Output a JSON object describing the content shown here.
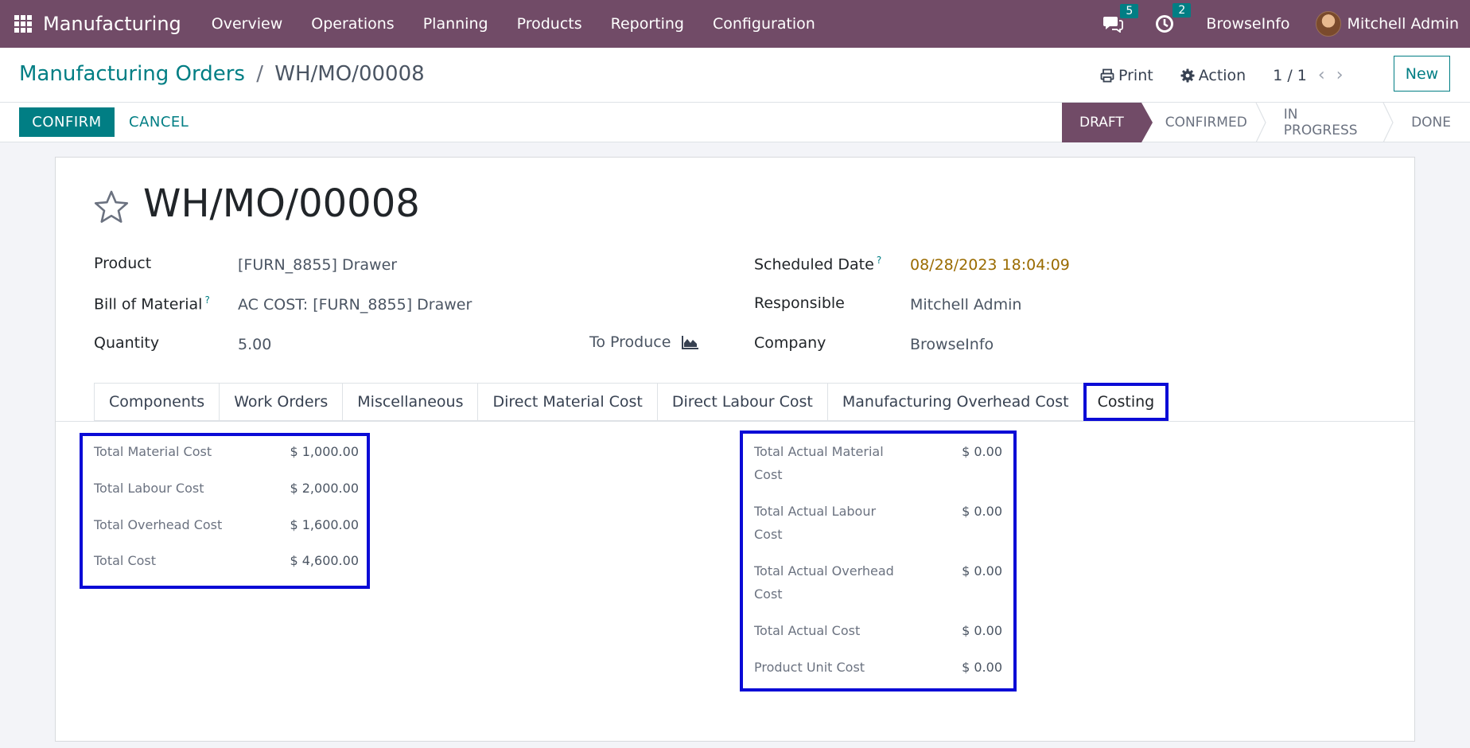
{
  "navbar": {
    "app_name": "Manufacturing",
    "menu": [
      "Overview",
      "Operations",
      "Planning",
      "Products",
      "Reporting",
      "Configuration"
    ],
    "messages_count": "5",
    "activities_count": "2",
    "company": "BrowseInfo",
    "user": "Mitchell Admin",
    "icons": [
      "apps-grid-icon",
      "chat-icon",
      "clock-icon"
    ]
  },
  "control": {
    "breadcrumb_parent": "Manufacturing Orders",
    "breadcrumb_sep": "/",
    "breadcrumb_current": "WH/MO/00008",
    "print_label": "Print",
    "action_label": "Action",
    "pager": "1 / 1",
    "new_label": "New"
  },
  "statusbar": {
    "confirm_label": "CONFIRM",
    "cancel_label": "CANCEL",
    "stages": [
      "DRAFT",
      "CONFIRMED",
      "IN PROGRESS",
      "DONE"
    ],
    "active_stage": "DRAFT",
    "active_color": "#714b67"
  },
  "form": {
    "title": "WH/MO/00008",
    "product_label": "Product",
    "product_value": "[FURN_8855] Drawer",
    "bom_label": "Bill of Material",
    "bom_help": "?",
    "bom_value": "AC COST: [FURN_8855] Drawer",
    "quantity_label": "Quantity",
    "quantity_value": "5.00",
    "to_produce_label": "To Produce",
    "scheduled_label": "Scheduled Date",
    "scheduled_help": "?",
    "scheduled_value": "08/28/2023 18:04:09",
    "responsible_label": "Responsible",
    "responsible_value": "Mitchell Admin",
    "company_label": "Company",
    "company_value": "BrowseInfo"
  },
  "tabs": [
    "Components",
    "Work Orders",
    "Miscellaneous",
    "Direct Material Cost",
    "Direct Labour Cost",
    "Manufacturing Overhead Cost",
    "Costing"
  ],
  "active_tab": "Costing",
  "highlight_color": "#0b0bd6",
  "costing_planned": [
    {
      "label": "Total Material Cost",
      "value": "$ 1,000.00"
    },
    {
      "label": "Total Labour Cost",
      "value": "$ 2,000.00"
    },
    {
      "label": "Total Overhead Cost",
      "value": "$ 1,600.00"
    },
    {
      "label": "Total Cost",
      "value": "$ 4,600.00"
    }
  ],
  "costing_actual": [
    {
      "label_1": "Total Actual Material",
      "label_2": "Cost",
      "value": "$ 0.00"
    },
    {
      "label_1": "Total Actual Labour",
      "label_2": "Cost",
      "value": "$ 0.00"
    },
    {
      "label_1": "Total Actual Overhead",
      "label_2": "Cost",
      "value": "$ 0.00"
    },
    {
      "label_1": "Total Actual Cost",
      "label_2": "",
      "value": "$ 0.00"
    },
    {
      "label_1": "Product Unit Cost",
      "label_2": "",
      "value": "$ 0.00"
    }
  ]
}
